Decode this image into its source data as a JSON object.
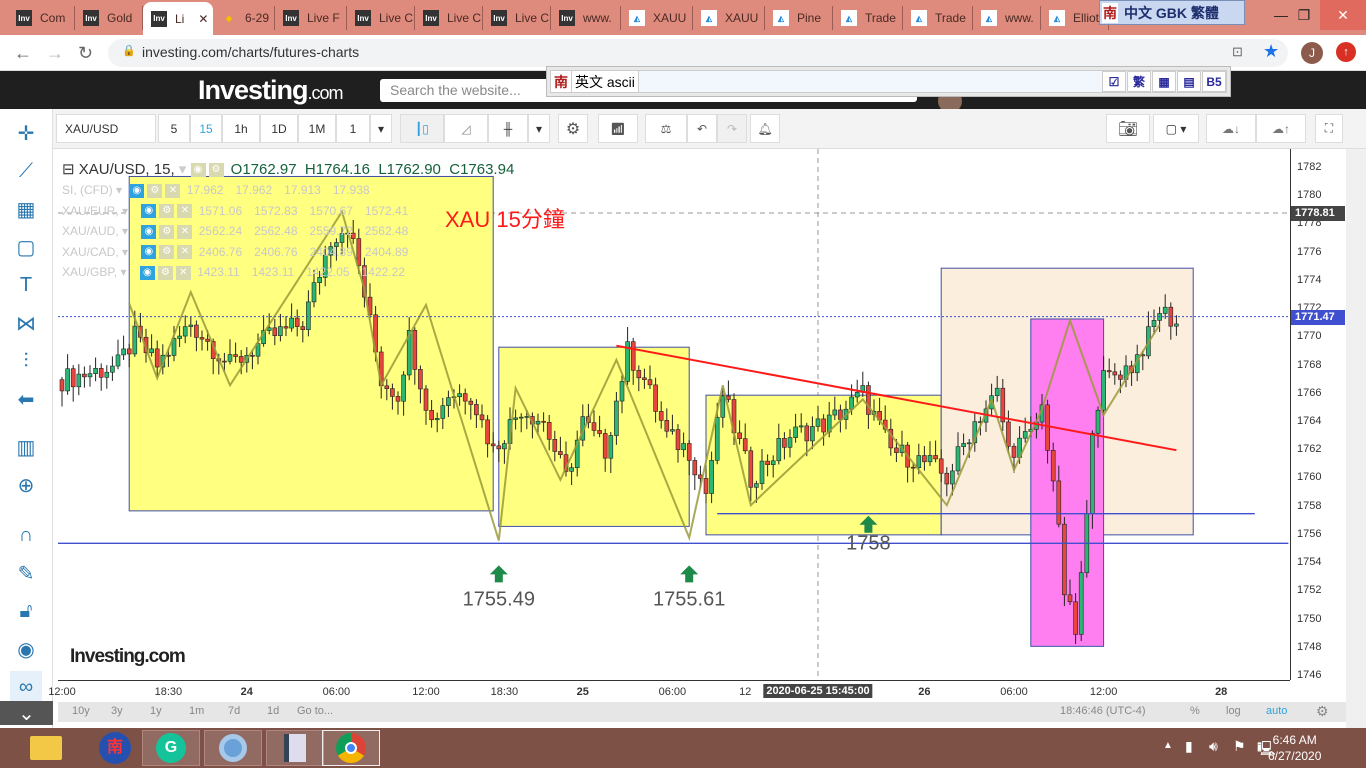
{
  "browser": {
    "tabs": [
      {
        "label": "Com",
        "icon": "inv"
      },
      {
        "label": "Gold",
        "icon": "inv"
      },
      {
        "label": "Li",
        "icon": "inv",
        "active": true
      },
      {
        "label": "6-29",
        "icon": "gem"
      },
      {
        "label": "Live F",
        "icon": "inv"
      },
      {
        "label": "Live C",
        "icon": "inv"
      },
      {
        "label": "Live C",
        "icon": "inv"
      },
      {
        "label": "Live C",
        "icon": "inv"
      },
      {
        "label": "www.",
        "icon": "inv"
      },
      {
        "label": "XAUU",
        "icon": "tv"
      },
      {
        "label": "XAUU",
        "icon": "tv"
      },
      {
        "label": "Pine",
        "icon": "tv"
      },
      {
        "label": "Trade",
        "icon": "tv"
      },
      {
        "label": "Trade",
        "icon": "tv"
      },
      {
        "label": "www.",
        "icon": "tv"
      },
      {
        "label": "Elliot",
        "icon": "tv"
      }
    ],
    "url": "investing.com/charts/futures-charts",
    "profile_initial": "J"
  },
  "ime": {
    "top_nan": "南",
    "top_label": "中文 GBK 繁體",
    "bar_nan": "南",
    "bar_mode": "英文 ascii",
    "bar_btn_trad": "繁",
    "bar_btn_b5": "B5"
  },
  "site": {
    "logo": "Investing",
    "logo_suffix": ".com",
    "search_placeholder": "Search the website..."
  },
  "toolbar": {
    "symbol": "XAU/USD",
    "intervals": [
      "5",
      "15",
      "1h",
      "1D",
      "1M",
      "1"
    ],
    "active_interval": "15"
  },
  "legend": {
    "title": "XAU/USD, 15,",
    "o": "O1762.97",
    "h": "H1764.16",
    "l": "L1762.90",
    "c": "C1763.94",
    "comparisons": [
      {
        "name": "SI, (CFD)",
        "values": [
          "17.962",
          "17.962",
          "17.913",
          "17.938"
        ]
      },
      {
        "name": "XAU/EUR,",
        "values": [
          "1571.06",
          "1572.83",
          "1570.67",
          "1572.41"
        ]
      },
      {
        "name": "XAU/AUD,",
        "values": [
          "2562.24",
          "2562.48",
          "2559.72",
          "2562.48"
        ]
      },
      {
        "name": "XAU/CAD,",
        "values": [
          "2406.76",
          "2406.76",
          "2404.89",
          "2404.89"
        ]
      },
      {
        "name": "XAU/GBP,",
        "values": [
          "1423.11",
          "1423.11",
          "1422.05",
          "1422.22"
        ]
      }
    ]
  },
  "chart_data": {
    "type": "candlestick",
    "symbol": "XAU/USD",
    "interval": "15",
    "ylim": [
      1746,
      1782
    ],
    "price_ticks": [
      1746,
      1748,
      1750,
      1752,
      1754,
      1756,
      1758,
      1760,
      1762,
      1764,
      1766,
      1768,
      1770,
      1772,
      1774,
      1776,
      1778,
      1780,
      1782
    ],
    "time_ticks": [
      {
        "i": 0,
        "label": "12:00"
      },
      {
        "i": 19,
        "label": "18:30"
      },
      {
        "i": 33,
        "label": "24",
        "bold": true
      },
      {
        "i": 49,
        "label": "06:00"
      },
      {
        "i": 65,
        "label": "12:00"
      },
      {
        "i": 79,
        "label": "18:30"
      },
      {
        "i": 93,
        "label": "25",
        "bold": true
      },
      {
        "i": 109,
        "label": "06:00"
      },
      {
        "i": 122,
        "label": "12"
      },
      {
        "i": 154,
        "label": "26",
        "bold": true
      },
      {
        "i": 170,
        "label": "06:00"
      },
      {
        "i": 186,
        "label": "12:00"
      },
      {
        "i": 207,
        "label": "28",
        "bold": true
      }
    ],
    "crosshair": {
      "i": 135,
      "label": "2020-06-25 15:45:00"
    },
    "price_waypoints": [
      [
        0,
        1767
      ],
      [
        10,
        1768
      ],
      [
        13,
        1770
      ],
      [
        17,
        1768
      ],
      [
        23,
        1771
      ],
      [
        30,
        1768
      ],
      [
        37,
        1770
      ],
      [
        43,
        1771
      ],
      [
        48,
        1777
      ],
      [
        51,
        1778
      ],
      [
        53,
        1775
      ],
      [
        57,
        1767
      ],
      [
        60,
        1766
      ],
      [
        62,
        1770
      ],
      [
        66,
        1764
      ],
      [
        69,
        1766
      ],
      [
        73,
        1766
      ],
      [
        77,
        1762
      ],
      [
        82,
        1765
      ],
      [
        86,
        1764
      ],
      [
        90,
        1760
      ],
      [
        93,
        1764
      ],
      [
        97,
        1762
      ],
      [
        101,
        1769
      ],
      [
        104,
        1767
      ],
      [
        108,
        1763
      ],
      [
        112,
        1762
      ],
      [
        115,
        1759
      ],
      [
        118,
        1766
      ],
      [
        123,
        1760
      ],
      [
        130,
        1763
      ],
      [
        137,
        1764
      ],
      [
        143,
        1766
      ],
      [
        148,
        1762
      ],
      [
        155,
        1761
      ],
      [
        158,
        1760
      ],
      [
        163,
        1764
      ],
      [
        167,
        1766
      ],
      [
        169,
        1762
      ],
      [
        173,
        1763
      ],
      [
        175,
        1765
      ],
      [
        177,
        1760
      ],
      [
        179,
        1752
      ],
      [
        181,
        1749
      ],
      [
        183,
        1757
      ],
      [
        184,
        1764
      ],
      [
        186,
        1767
      ],
      [
        191,
        1768
      ],
      [
        194,
        1770
      ],
      [
        196,
        1772
      ],
      [
        199,
        1771
      ]
    ],
    "last_price": "1771.47",
    "marked_price": "1778.81",
    "zigzag": [
      [
        12,
        1772.4
      ],
      [
        17,
        1767.1
      ],
      [
        23,
        1773.2
      ],
      [
        30,
        1766.6
      ],
      [
        50,
        1778.9
      ],
      [
        54,
        1773.4
      ],
      [
        57,
        1766.6
      ],
      [
        65,
        1772.3
      ],
      [
        78,
        1755.6
      ],
      [
        81,
        1766.4
      ],
      [
        89,
        1759.9
      ],
      [
        99,
        1768.4
      ],
      [
        112,
        1755.8
      ],
      [
        118,
        1766.6
      ],
      [
        123,
        1758.1
      ],
      [
        143,
        1765.6
      ],
      [
        158,
        1758.1
      ],
      [
        166,
        1765.6
      ],
      [
        170,
        1760.6
      ],
      [
        175,
        1764.9
      ],
      [
        180,
        1771.2
      ],
      [
        186,
        1764.5
      ],
      [
        196,
        1770.9
      ]
    ],
    "boxes": [
      {
        "from": 12,
        "to": 77,
        "low": 1757.7,
        "high": 1781.4,
        "color": "#ffff80"
      },
      {
        "from": 78,
        "to": 112,
        "low": 1756.6,
        "high": 1769.3,
        "color": "#ffff80"
      },
      {
        "from": 115,
        "to": 157,
        "low": 1756.0,
        "high": 1765.9,
        "color": "#ffff80"
      },
      {
        "from": 157,
        "to": 202,
        "low": 1756.0,
        "high": 1774.9,
        "color": "#fbeedc"
      },
      {
        "from": 173,
        "to": 186,
        "low": 1748.1,
        "high": 1771.3,
        "color": "#ff7ef0"
      }
    ],
    "trendline": {
      "from": [
        99,
        1769.4
      ],
      "to": [
        199,
        1762.0
      ],
      "color": "#ff1a1a"
    },
    "support_lines": [
      {
        "price": 1755.4,
        "from": -1,
        "to": 219
      },
      {
        "price": 1757.5,
        "from": 117,
        "to": 213
      }
    ],
    "annotations": [
      {
        "i": 78,
        "price": 1755.49,
        "label": "1755.49"
      },
      {
        "i": 112,
        "price": 1755.61,
        "label": "1755.61"
      },
      {
        "i": 144,
        "price": 1758,
        "label": "1758"
      }
    ],
    "note": "XAU 15分鐘"
  },
  "bottom": {
    "ranges": [
      "10y",
      "3y",
      "1y",
      "1m",
      "7d",
      "1d",
      "Go to..."
    ],
    "time": "18:46:46 (UTC-4)",
    "pct": "%",
    "log": "log",
    "auto": "auto"
  },
  "watermark": "Investing.com",
  "taskbar": {
    "time": "6:46 AM",
    "date": "6/27/2020"
  }
}
